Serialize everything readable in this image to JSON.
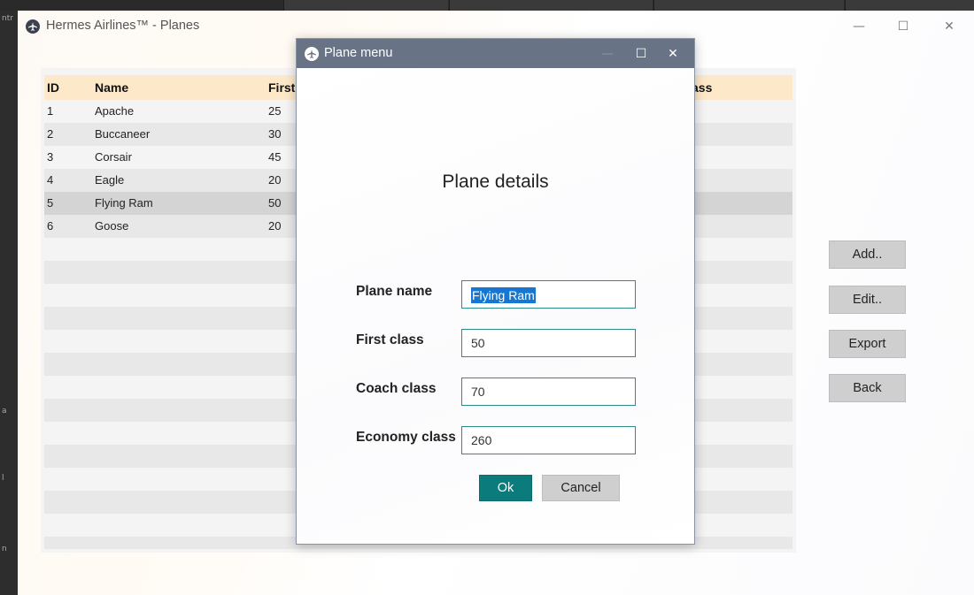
{
  "background": {
    "left_labels": [
      "ntr",
      "a",
      "l",
      "n"
    ]
  },
  "main_window": {
    "title": "Hermes Airlines™  -  Planes",
    "controls": {
      "minimize": "—",
      "maximize": "☐",
      "close": "✕"
    }
  },
  "grid": {
    "columns": [
      "ID",
      "Name",
      "First",
      "ass"
    ],
    "rows": [
      {
        "id": "1",
        "name": "Apache",
        "first": "25"
      },
      {
        "id": "2",
        "name": "Buccaneer",
        "first": "30"
      },
      {
        "id": "3",
        "name": "Corsair",
        "first": "45"
      },
      {
        "id": "4",
        "name": "Eagle",
        "first": "20"
      },
      {
        "id": "5",
        "name": "Flying Ram",
        "first": "50"
      },
      {
        "id": "6",
        "name": "Goose",
        "first": "20"
      }
    ],
    "selected_row_index": 4
  },
  "side_buttons": {
    "add": "Add..",
    "edit": "Edit..",
    "export": "Export",
    "back": "Back"
  },
  "modal": {
    "title": "Plane menu",
    "controls": {
      "minimize": "—",
      "maximize": "☐",
      "close": "✕"
    },
    "heading": "Plane details",
    "fields": {
      "plane_name": {
        "label": "Plane name",
        "value": "Flying Ram"
      },
      "first_class": {
        "label": "First class",
        "value": "50"
      },
      "coach_class": {
        "label": "Coach class",
        "value": "70"
      },
      "economy_class": {
        "label": "Economy class",
        "value": "260"
      }
    },
    "ok_label": "Ok",
    "cancel_label": "Cancel"
  },
  "colors": {
    "header_bg": "#fde9c9",
    "accent_teal": "#0c7b7b",
    "modal_title_bg": "#687385",
    "selection_blue": "#1577d1",
    "selected_row": "#d4d4d4"
  }
}
